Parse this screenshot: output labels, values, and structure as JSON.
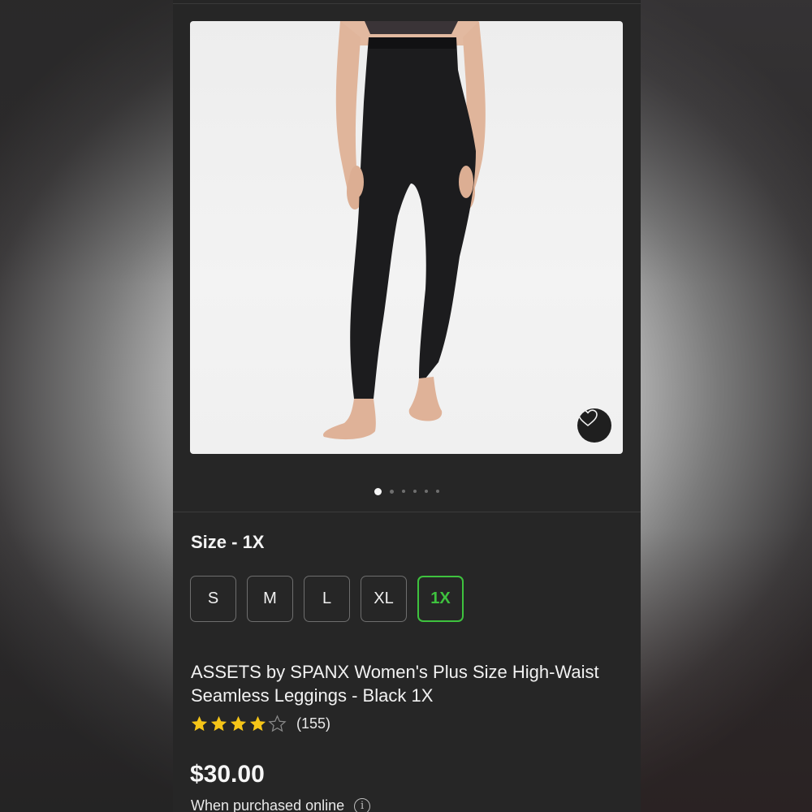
{
  "product": {
    "title": "ASSETS by SPANX Women's Plus Size High-Waist Seamless Leggings - Black 1X",
    "rating": 4,
    "rating_max": 5,
    "review_count": "(155)",
    "price": "$30.00",
    "price_note": "When purchased online"
  },
  "gallery": {
    "image_count": 6,
    "active_index": 0,
    "favorite_icon": "heart-outline-icon"
  },
  "size": {
    "heading": "Size - 1X",
    "options": [
      "S",
      "M",
      "L",
      "XL",
      "1X"
    ],
    "selected": "1X"
  },
  "colors": {
    "page_background": "#262626",
    "selected_accent": "#3ec23e",
    "star_color": "#f5c518"
  }
}
